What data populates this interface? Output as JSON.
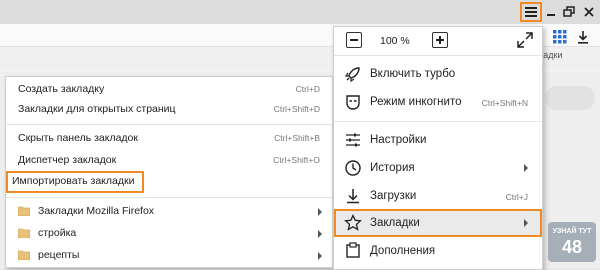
{
  "window": {
    "menu_icon": "hamburger-icon",
    "minimize_icon": "minimize-icon",
    "restore_icon": "restore-icon",
    "close_icon": "close-icon"
  },
  "background": {
    "bookmarks_label": "ладки"
  },
  "bookmarks_submenu": {
    "items": [
      {
        "label": "Создать закладку",
        "shortcut": "Ctrl+D"
      },
      {
        "label": "Закладки для открытых страниц",
        "shortcut": "Ctrl+Shift+D"
      },
      {
        "label": "Скрыть панель закладок",
        "shortcut": "Ctrl+Shift+B"
      },
      {
        "label": "Диспетчер закладок",
        "shortcut": "Ctrl+Shift+O"
      },
      {
        "label": "Импортировать закладки",
        "shortcut": ""
      }
    ],
    "folders": [
      {
        "label": "Закладки Mozilla Firefox"
      },
      {
        "label": "стройка"
      },
      {
        "label": "рецепты"
      }
    ]
  },
  "main_menu": {
    "zoom": "100 %",
    "items": [
      {
        "label": "Включить турбо",
        "shortcut": "",
        "icon": "rocket-icon"
      },
      {
        "label": "Режим инкогнито",
        "shortcut": "Ctrl+Shift+N",
        "icon": "incognito-mask-icon"
      },
      {
        "label": "Настройки",
        "shortcut": "",
        "icon": "settings-sliders-icon"
      },
      {
        "label": "История",
        "shortcut": "",
        "icon": "clock-icon"
      },
      {
        "label": "Загрузки",
        "shortcut": "Ctrl+J",
        "icon": "download-icon"
      },
      {
        "label": "Закладки",
        "shortcut": "",
        "icon": "star-icon"
      },
      {
        "label": "Дополнения",
        "shortcut": "",
        "icon": "extensions-icon"
      }
    ]
  },
  "highlight_color": "#f08a24",
  "watermark": {
    "line1": "узнай тут",
    "line2": "48"
  }
}
